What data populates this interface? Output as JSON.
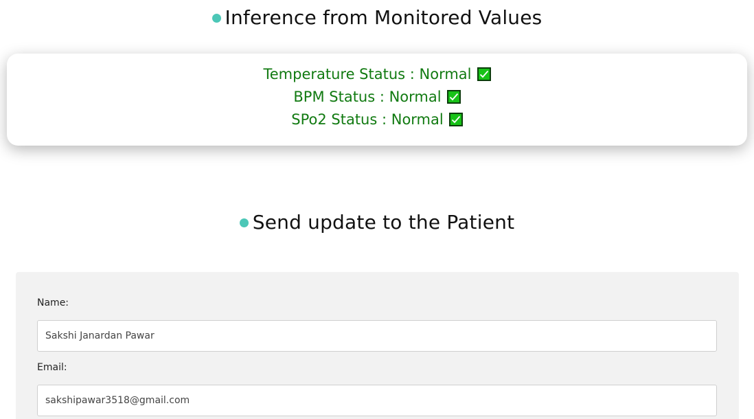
{
  "inference": {
    "heading": "Inference from Monitored Values",
    "statuses": [
      {
        "text": "Temperature Status : Normal"
      },
      {
        "text": "BPM Status : Normal"
      },
      {
        "text": "SPo2 Status : Normal"
      }
    ],
    "check_icon": "check-box-icon",
    "text_color": "#117a11",
    "check_color": "#18c218"
  },
  "update": {
    "heading": "Send update to the Patient",
    "name_label": "Name:",
    "name_value": "Sakshi Janardan Pawar",
    "email_label": "Email:",
    "email_value": "sakshipawar3518@gmail.com"
  },
  "accent_color": "#4cc7b7"
}
